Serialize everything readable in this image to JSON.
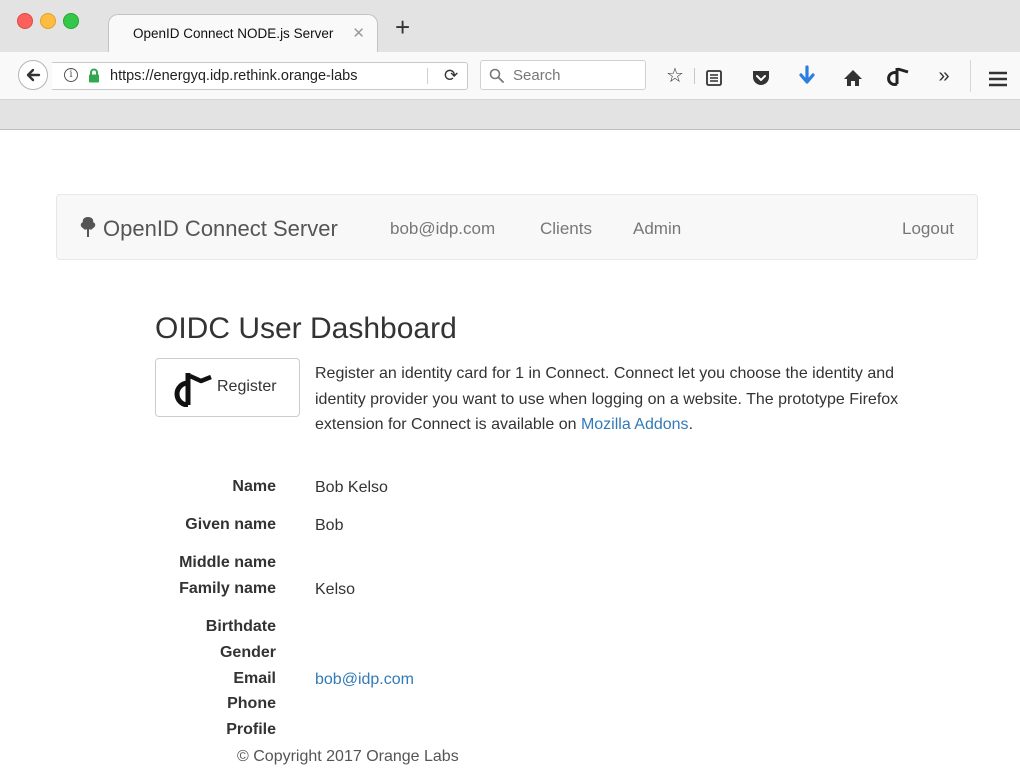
{
  "browser": {
    "tab_title": "OpenID Connect NODE.js Server",
    "tab_close": "✕",
    "new_tab": "+",
    "url": "https://energyq.idp.rethink.orange-labs",
    "search_placeholder": "Search",
    "overflow": "»"
  },
  "navbar": {
    "brand": "OpenID Connect Server",
    "user": "bob@idp.com",
    "clients": "Clients",
    "admin": "Admin",
    "logout": "Logout"
  },
  "dashboard": {
    "title": "OIDC User Dashboard",
    "register_label": "Register",
    "description_text": "Register an identity card for 1 in Connect. Connect let you choose the identity and identity provider you want to use when logging on a website. The prototype Firefox extension for Connect is available on ",
    "description_link": "Mozilla Addons",
    "description_end": "."
  },
  "profile": {
    "name_label": "Name",
    "name_value": "Bob Kelso",
    "given_label": "Given name",
    "given_value": "Bob",
    "middle_label": "Middle name",
    "middle_value": "",
    "family_label": "Family name",
    "family_value": "Kelso",
    "birthdate_label": "Birthdate",
    "birthdate_value": "",
    "gender_label": "Gender",
    "gender_value": "",
    "email_label": "Email",
    "email_value": "bob@idp.com",
    "phone_label": "Phone",
    "phone_value": "",
    "profile_label": "Profile",
    "profile_value": ""
  },
  "footer": {
    "copyright": "© Copyright 2017 Orange Labs"
  },
  "colors": {
    "link": "#337ab7",
    "download_arrow": "#2a7de1"
  }
}
